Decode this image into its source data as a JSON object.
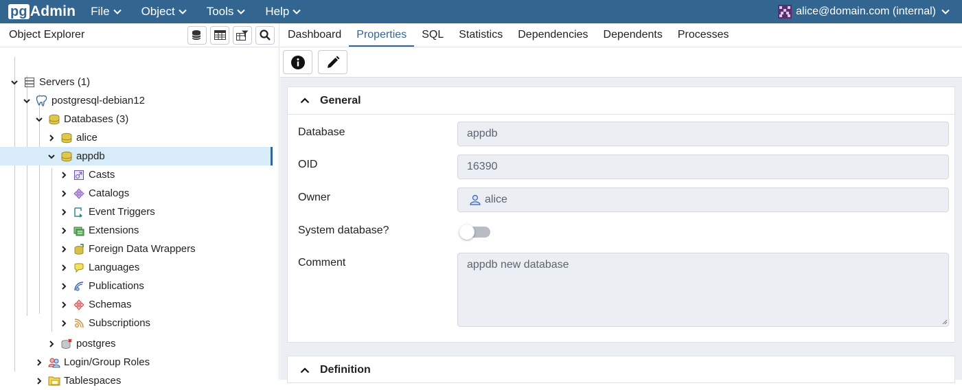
{
  "app": {
    "logo_pg": "pg",
    "logo_text": "Admin"
  },
  "menu": [
    {
      "label": "File"
    },
    {
      "label": "Object"
    },
    {
      "label": "Tools"
    },
    {
      "label": "Help"
    }
  ],
  "user": {
    "label": "alice@domain.com (internal)"
  },
  "explorer": {
    "title": "Object Explorer",
    "tree": [
      {
        "label": "Servers (1)",
        "icon": "servers-icon"
      },
      {
        "label": "postgresql-debian12",
        "icon": "elephant-icon"
      },
      {
        "label": "Databases (3)",
        "icon": "databases-icon"
      },
      {
        "label": "alice",
        "icon": "database-icon"
      },
      {
        "label": "appdb",
        "icon": "database-icon"
      },
      {
        "label": "Casts",
        "icon": "casts-icon"
      },
      {
        "label": "Catalogs",
        "icon": "catalogs-icon"
      },
      {
        "label": "Event Triggers",
        "icon": "event-triggers-icon"
      },
      {
        "label": "Extensions",
        "icon": "extensions-icon"
      },
      {
        "label": "Foreign Data Wrappers",
        "icon": "fdw-icon"
      },
      {
        "label": "Languages",
        "icon": "languages-icon"
      },
      {
        "label": "Publications",
        "icon": "publications-icon"
      },
      {
        "label": "Schemas",
        "icon": "schemas-icon"
      },
      {
        "label": "Subscriptions",
        "icon": "subscriptions-icon"
      },
      {
        "label": "postgres",
        "icon": "database-disconnected-icon"
      },
      {
        "label": "Login/Group Roles",
        "icon": "roles-icon"
      },
      {
        "label": "Tablespaces",
        "icon": "tablespaces-icon"
      }
    ]
  },
  "tabs": [
    {
      "label": "Dashboard"
    },
    {
      "label": "Properties"
    },
    {
      "label": "SQL"
    },
    {
      "label": "Statistics"
    },
    {
      "label": "Dependencies"
    },
    {
      "label": "Dependents"
    },
    {
      "label": "Processes"
    }
  ],
  "active_tab": "Properties",
  "general": {
    "title": "General",
    "database_label": "Database",
    "database_value": "appdb",
    "oid_label": "OID",
    "oid_value": "16390",
    "owner_label": "Owner",
    "owner_value": "alice",
    "system_label": "System database?",
    "system_value": false,
    "comment_label": "Comment",
    "comment_value": "appdb new database"
  },
  "definition": {
    "title": "Definition"
  },
  "colors": {
    "header": "#326690",
    "selected_row": "#d7ebf8",
    "field_bg": "#ebeef3"
  }
}
